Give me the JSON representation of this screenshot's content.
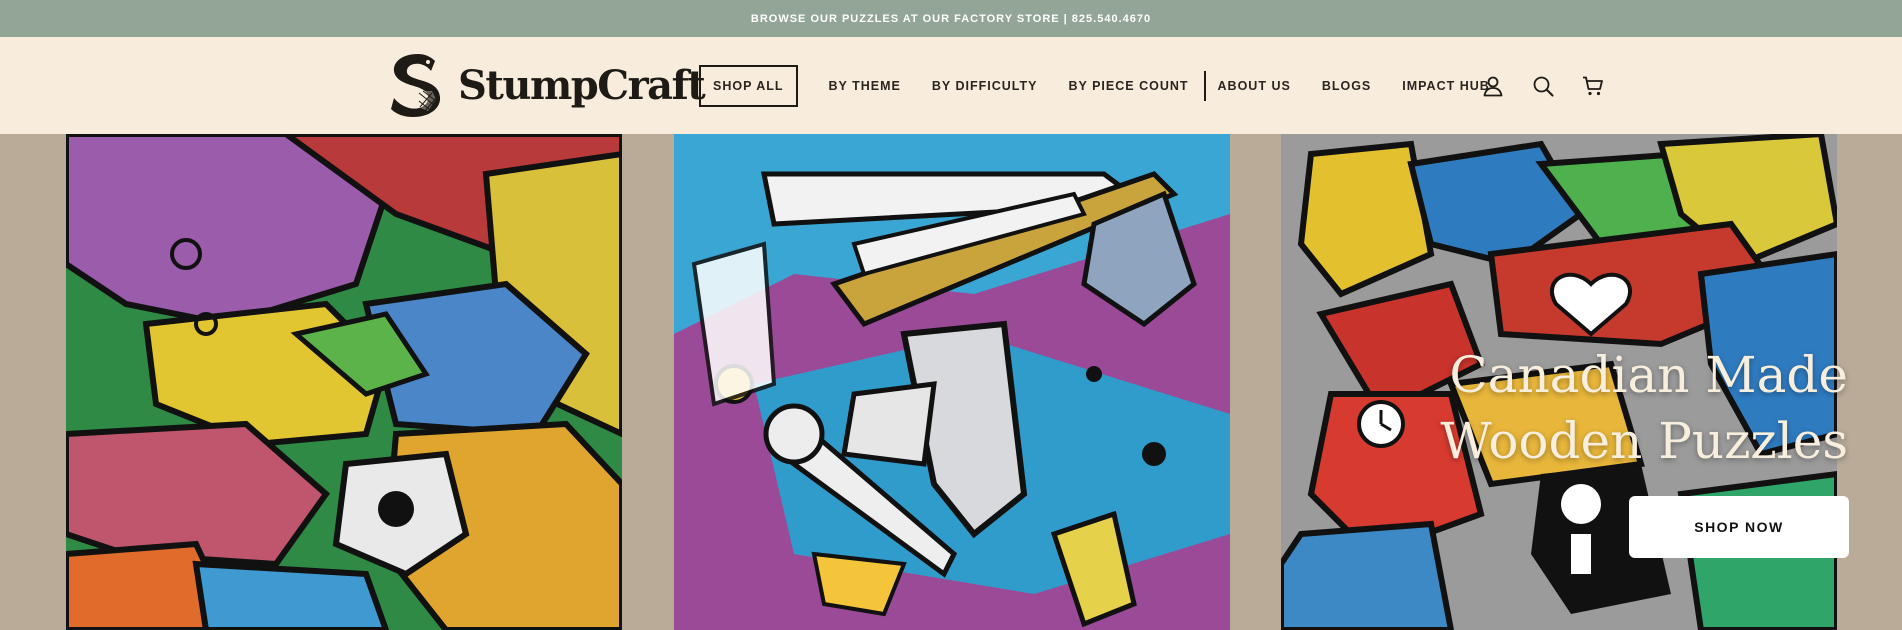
{
  "announcement": {
    "text": "BROWSE OUR PUZZLES AT OUR FACTORY STORE | 825.540.4670"
  },
  "brand": {
    "name": "StumpCraft",
    "logo_icon": "beaver-s-icon"
  },
  "nav": {
    "items": [
      {
        "label": "SHOP ALL"
      },
      {
        "label": "BY THEME"
      },
      {
        "label": "BY DIFFICULTY"
      },
      {
        "label": "BY PIECE COUNT"
      },
      {
        "label": "ABOUT US"
      },
      {
        "label": "BLOGS"
      },
      {
        "label": "IMPACT HUB"
      }
    ],
    "icons": [
      "account-icon",
      "search-icon",
      "cart-icon"
    ]
  },
  "hero": {
    "headline_line1": "Canadian Made",
    "headline_line2": "Wooden Puzzles",
    "cta_label": "SHOP NOW",
    "panels": [
      "dinosaur-puzzle-art",
      "space-puzzle-art",
      "canadian-icons-puzzle-art"
    ]
  },
  "colors": {
    "announcement_bg": "#93a597",
    "header_bg": "#f8eddc",
    "hero_bg": "#b9ab98",
    "text_dark": "#1e1a16"
  }
}
